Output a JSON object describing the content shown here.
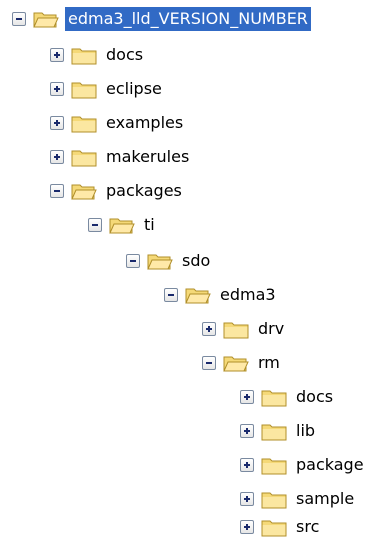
{
  "tree": {
    "root": {
      "label": "edma3_lld_VERSION_NUMBER",
      "state": "expanded",
      "selected": true
    },
    "items": [
      {
        "label": "docs",
        "state": "collapsed"
      },
      {
        "label": "eclipse",
        "state": "collapsed"
      },
      {
        "label": "examples",
        "state": "collapsed"
      },
      {
        "label": "makerules",
        "state": "collapsed"
      },
      {
        "label": "packages",
        "state": "expanded"
      },
      {
        "label": "ti",
        "state": "expanded"
      },
      {
        "label": "sdo",
        "state": "expanded"
      },
      {
        "label": "edma3",
        "state": "expanded"
      },
      {
        "label": "drv",
        "state": "collapsed"
      },
      {
        "label": "rm",
        "state": "expanded"
      },
      {
        "label": "docs",
        "state": "collapsed"
      },
      {
        "label": "lib",
        "state": "collapsed"
      },
      {
        "label": "package",
        "state": "collapsed"
      },
      {
        "label": "sample",
        "state": "collapsed"
      },
      {
        "label": "src",
        "state": "collapsed"
      }
    ]
  },
  "colors": {
    "selection": "#316ac5",
    "folder": "#f5d978",
    "folder_outline": "#b08f2a"
  },
  "icons": {
    "folder": "folder-icon",
    "expand": "plus-box-icon",
    "collapse": "minus-box-icon"
  }
}
